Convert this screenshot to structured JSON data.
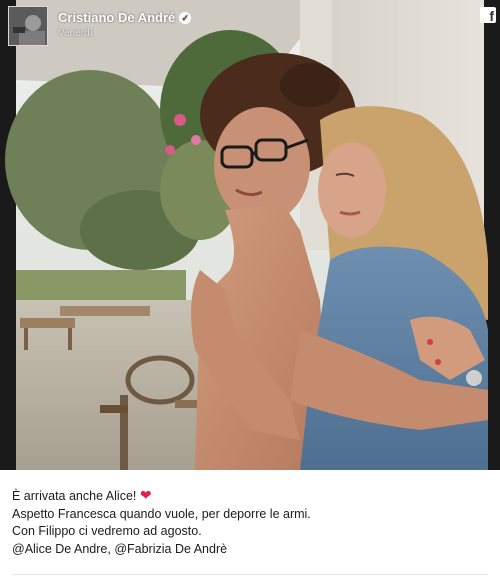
{
  "post": {
    "author": "Cristiano De André",
    "timestamp": "Venerdì",
    "verified_icon": "check-badge-icon",
    "source_icon": "facebook-icon",
    "caption": {
      "line1_text": "È arrivata anche Alice!",
      "line1_emoji": "❤",
      "line2": "Aspetto Francesca quando vuole, per deporre le armi.",
      "line3": "Con Filippo ci vedremo ad agosto.",
      "line4": "@Alice De Andre, @Fabrizia De Andrè"
    }
  },
  "colors": {
    "heart": "#e0234a",
    "text": "#1c1c1c"
  }
}
